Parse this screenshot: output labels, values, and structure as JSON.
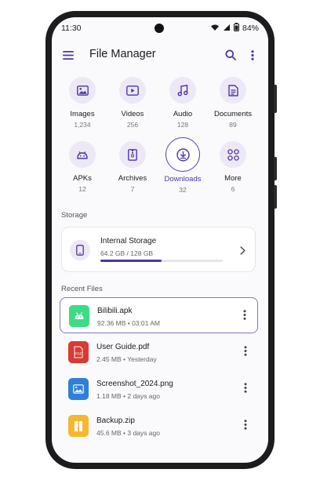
{
  "status_bar": {
    "time": "11:30",
    "battery": "84%"
  },
  "app_bar": {
    "title": "File Manager"
  },
  "categories": [
    {
      "label": "Images",
      "count": "1,234",
      "icon": "image-icon"
    },
    {
      "label": "Videos",
      "count": "256",
      "icon": "video-icon"
    },
    {
      "label": "Audio",
      "count": "128",
      "icon": "music-note-icon"
    },
    {
      "label": "Documents",
      "count": "89",
      "icon": "document-icon"
    },
    {
      "label": "APKs",
      "count": "12",
      "icon": "android-icon"
    },
    {
      "label": "Archives",
      "count": "7",
      "icon": "archive-icon"
    },
    {
      "label": "Downloads",
      "count": "32",
      "icon": "download-icon",
      "selected": true
    },
    {
      "label": "More",
      "count": "6",
      "icon": "more-grid-icon"
    }
  ],
  "storage": {
    "section_title": "Storage",
    "name": "Internal Storage",
    "usage": "64.2 GB / 128 GB",
    "used_fraction": 0.5
  },
  "recent": {
    "section_title": "Recent Files",
    "files": [
      {
        "name": "Bilibili.apk",
        "meta": "92.36 MB  •  03:01 AM",
        "icon": "android-file-icon",
        "color": "#3ddc84",
        "selected": true
      },
      {
        "name": "User Guide.pdf",
        "meta": "2.45 MB  •  Yesterday",
        "icon": "pdf-file-icon",
        "color": "#d93a33"
      },
      {
        "name": "Screenshot_2024.png",
        "meta": "1.18 MB  •  2 days ago",
        "icon": "image-file-icon",
        "color": "#2f80d8"
      },
      {
        "name": "Backup.zip",
        "meta": "45.6 MB  •  3 days ago",
        "icon": "zip-file-icon",
        "color": "#f5b731"
      }
    ]
  },
  "colors": {
    "accent": "#4f35a0",
    "category_bg": "#ece8f6"
  }
}
